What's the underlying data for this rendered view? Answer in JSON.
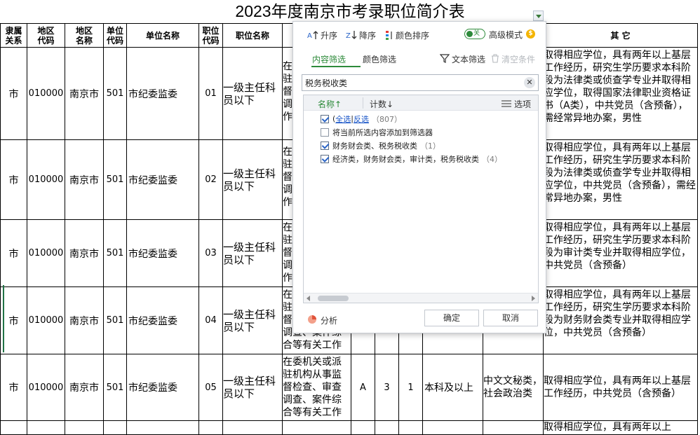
{
  "sheet": {
    "title": "2023年度南京市考录职位简介表",
    "headers": {
      "relation": "隶属\n关系",
      "area_code": "地区\n代码",
      "area_name": "地区\n名称",
      "unit_code": "单位\n代码",
      "unit_name": "单位名称",
      "pos_code": "职位\n代码",
      "pos_name": "职位名称",
      "other": "其    它"
    },
    "rows": [
      {
        "relation": "市",
        "area_code": "010000",
        "area_name": "南京市",
        "unit_code": "501",
        "unit_name": "市纪委监委",
        "pos_code": "01",
        "pos_name": "一级主任科员以下",
        "intro": "在\n驻\n督\n调\n作",
        "other": "取得相应学位，具有两年以上基层工作经历，研究生学历要求本科阶段为法律类或侦查学专业并取得相应学位，取得国家法律职业资格证书（A类），中共党员（含预备），需经常异地办案，男性"
      },
      {
        "relation": "市",
        "area_code": "010000",
        "area_name": "南京市",
        "unit_code": "501",
        "unit_name": "市纪委监委",
        "pos_code": "02",
        "pos_name": "一级主任科员以下",
        "intro": "在\n驻\n督\n调\n作",
        "other": "取得相应学位，具有两年以上基层工作经历，研究生学历要求本科阶段为法律类或侦查学专业并取得相应学位，中共党员（含预备），需经常异地办案，男性"
      },
      {
        "relation": "市",
        "area_code": "010000",
        "area_name": "南京市",
        "unit_code": "501",
        "unit_name": "市纪委监委",
        "pos_code": "03",
        "pos_name": "一级主任科员以下",
        "intro": "在\n驻\n督\n调\n作",
        "other": "取得相应学位，具有两年以上基层工作经历，研究生学历要求本科阶段为审计类专业并取得相应学位，中共党员（含预备）"
      },
      {
        "relation": "市",
        "area_code": "010000",
        "area_name": "南京市",
        "unit_code": "501",
        "unit_name": "市纪委监委",
        "pos_code": "04",
        "pos_name": "一级主任科员以下",
        "intro": "在\n驻\n督\n调查、案件综合等有关工作",
        "other": "取得相应学位，具有两年以上基层工作经历，研究生学历要求本科阶段为财务财会类专业并取得相应学位，中共党员（含预备）"
      },
      {
        "relation": "市",
        "area_code": "010000",
        "area_name": "南京市",
        "unit_code": "501",
        "unit_name": "市纪委监委",
        "pos_code": "05",
        "pos_name": "一级主任科员以下",
        "intro": "在委机关或派驻机构从事监督检查、审查调查、案件综合等有关工作",
        "exam_type": "A",
        "count1": "3",
        "count2": "1",
        "education": "本科及以上",
        "major": "中文文秘类，社会政治类",
        "other": "取得相应学位，具有两年以上基层工作经历，中共党员（含预备）"
      },
      {
        "other": "取得相应学位，具有两年以上"
      }
    ]
  },
  "dialog": {
    "toolbar": {
      "asc": "升序",
      "desc": "降序",
      "color_sort": "颜色排序",
      "toggle_state": "关",
      "advanced": "高级模式",
      "coin": "$"
    },
    "tabs": {
      "content_filter": "内容筛选",
      "color_filter": "颜色筛选",
      "text_filter": "文本筛选",
      "clear": "清空条件"
    },
    "search": {
      "value": "税务税收类"
    },
    "list": {
      "col_name": "名称↑",
      "col_count": "计数↓",
      "col_options": "选项",
      "select_all": "全选",
      "invert": "反选",
      "all_count": "（807）",
      "add_to_filter": "将当前所选内容添加到筛选器",
      "items": [
        {
          "label": "财务财会类、税务税收类",
          "count": "（1）",
          "checked": true
        },
        {
          "label": "经济类，财务财会类，审计类，税务税收类",
          "count": "（4）",
          "checked": true
        }
      ]
    },
    "analysis": "分析",
    "ok": "确定",
    "cancel": "取消"
  }
}
